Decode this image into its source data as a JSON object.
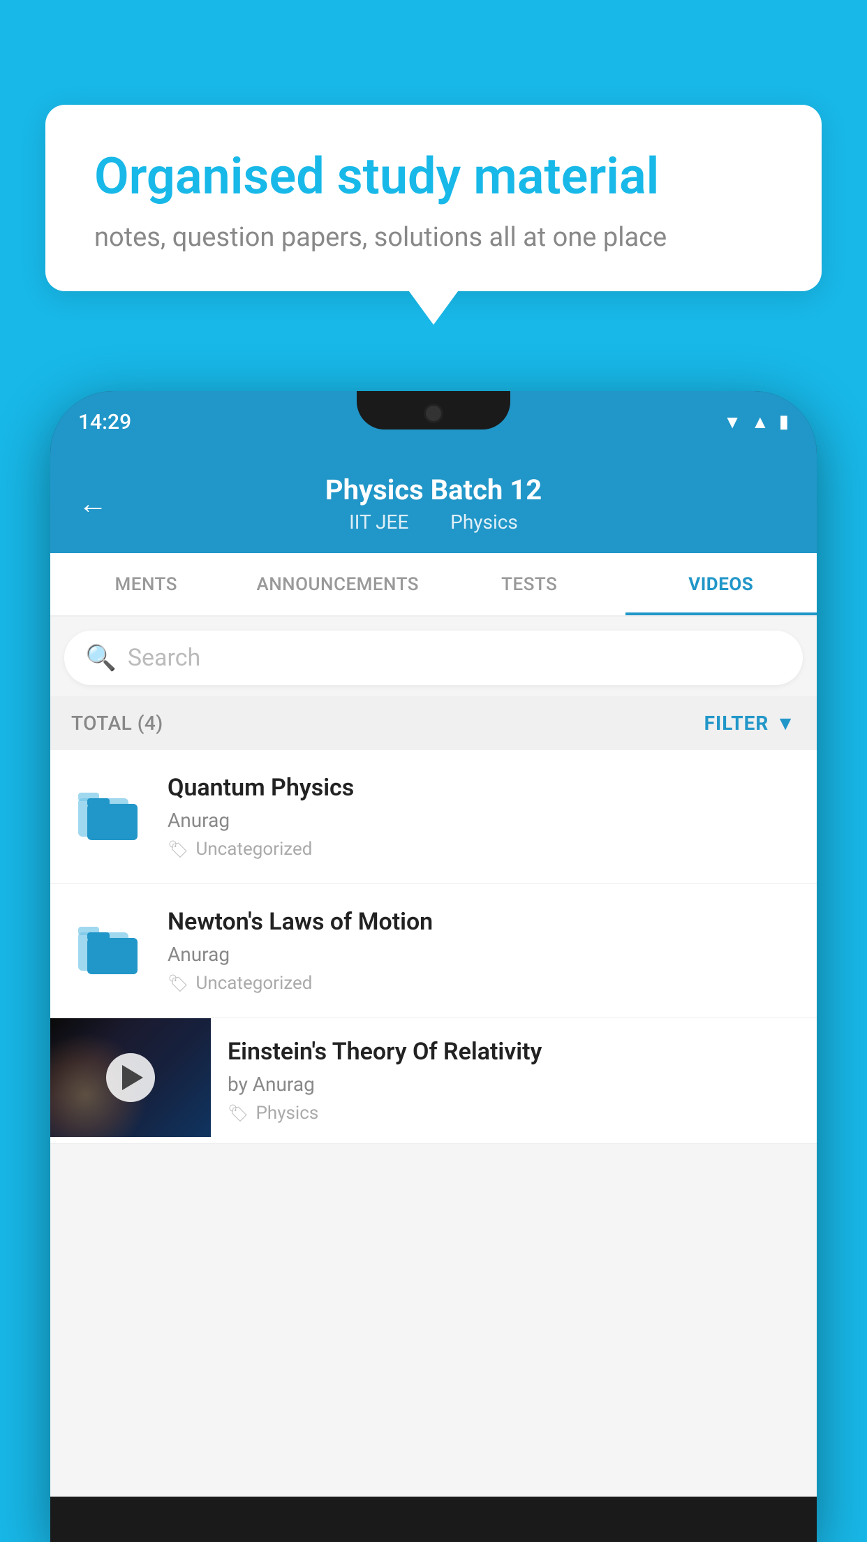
{
  "background_color": "#18B8E8",
  "speech_bubble": {
    "title": "Organised study material",
    "subtitle": "notes, question papers, solutions all at one place"
  },
  "status_bar": {
    "time": "14:29",
    "icons": [
      "wifi",
      "signal",
      "battery"
    ]
  },
  "app_header": {
    "back_label": "←",
    "title": "Physics Batch 12",
    "subtitle_part1": "IIT JEE",
    "subtitle_separator": "  ",
    "subtitle_part2": "Physics"
  },
  "tabs": [
    {
      "label": "MENTS",
      "active": false
    },
    {
      "label": "ANNOUNCEMENTS",
      "active": false
    },
    {
      "label": "TESTS",
      "active": false
    },
    {
      "label": "VIDEOS",
      "active": true
    }
  ],
  "search": {
    "placeholder": "Search"
  },
  "filter_bar": {
    "total_label": "TOTAL (4)",
    "filter_label": "FILTER"
  },
  "videos": [
    {
      "id": 1,
      "title": "Quantum Physics",
      "author": "Anurag",
      "tag": "Uncategorized",
      "has_thumbnail": false
    },
    {
      "id": 2,
      "title": "Newton's Laws of Motion",
      "author": "Anurag",
      "tag": "Uncategorized",
      "has_thumbnail": false
    },
    {
      "id": 3,
      "title": "Einstein's Theory Of Relativity",
      "author": "by Anurag",
      "tag": "Physics",
      "has_thumbnail": true
    }
  ]
}
